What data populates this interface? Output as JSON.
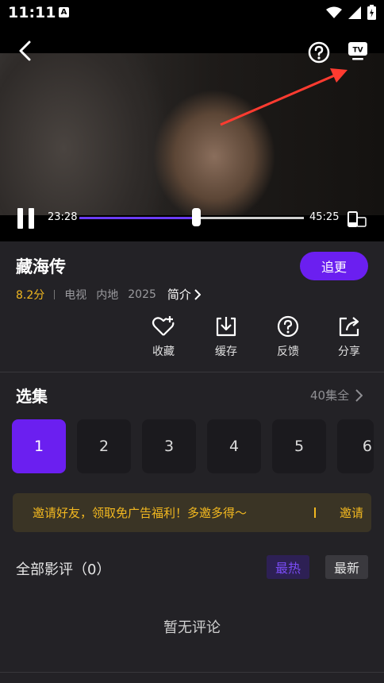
{
  "status_bar": {
    "time": "11:11",
    "notification_icon": "A"
  },
  "player": {
    "current_time": "23:28",
    "total_time": "45:25",
    "progress": 0.52,
    "icons": [
      "back-icon",
      "help-icon",
      "tv-cast-icon",
      "pause-icon",
      "rotate-screen-icon"
    ]
  },
  "show": {
    "title": "藏海传",
    "follow_label": "追更",
    "score": "8.2分",
    "type": "电视",
    "region": "内地",
    "year": "2025",
    "intro_label": "简介"
  },
  "actions": [
    {
      "label": "收藏",
      "icon": "favorite-heart-icon"
    },
    {
      "label": "缓存",
      "icon": "download-icon"
    },
    {
      "label": "反馈",
      "icon": "feedback-help-icon"
    },
    {
      "label": "分享",
      "icon": "share-icon"
    }
  ],
  "episodes": {
    "section_title": "选集",
    "total_label": "40集全",
    "items": [
      "1",
      "2",
      "3",
      "4",
      "5",
      "6"
    ],
    "selected": "1"
  },
  "invite": {
    "text": "邀请好友，领取免广告福利！多邀多得～",
    "action_label": "邀请"
  },
  "reviews": {
    "title": "全部影评（0）",
    "sort_hot": "最热",
    "sort_new": "最新",
    "empty_text": "暂无评论"
  },
  "colors": {
    "accent": "#6b1ff0",
    "score": "#f2b820",
    "background": "#232226"
  }
}
